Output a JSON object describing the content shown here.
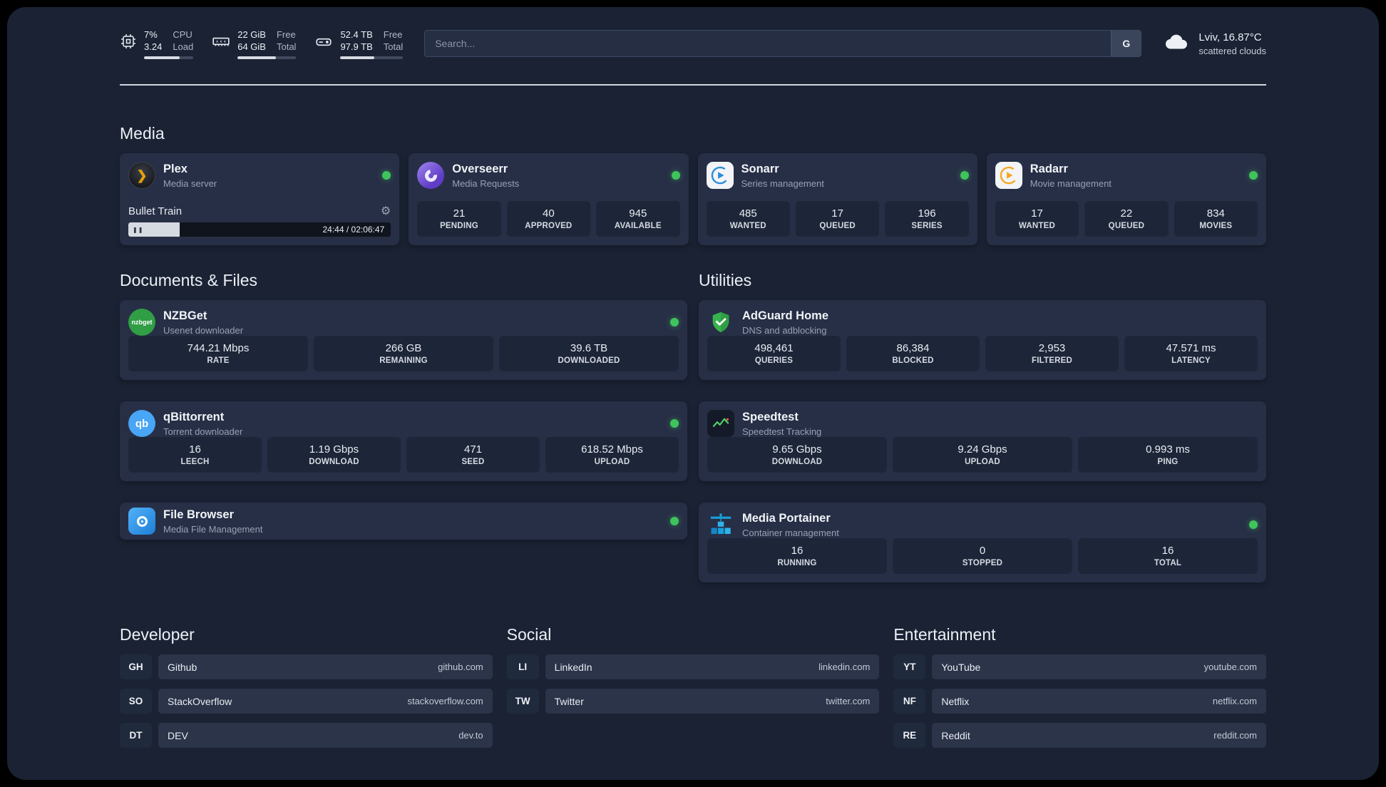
{
  "colors": {
    "background": "#1a2234",
    "card": "#272f46",
    "stat_box": "#1d2638",
    "status_green": "#3fc35c",
    "plex_accent": "#e5a00d"
  },
  "icons": {
    "gear": "⚙",
    "pause": "❚❚",
    "plex_chevron": "❯",
    "qbittorrent_label": "qb",
    "nzbget_label": "nzbget"
  },
  "topbar": {
    "cpu": {
      "value_top": "7%",
      "value_bottom": "3.24",
      "label_top": "CPU",
      "label_bottom": "Load",
      "progress": 72
    },
    "ram": {
      "value_top": "22 GiB",
      "value_bottom": "64 GiB",
      "label_top": "Free",
      "label_bottom": "Total",
      "progress": 66
    },
    "disk": {
      "value_top": "52.4 TB",
      "value_bottom": "97.9 TB",
      "label_top": "Free",
      "label_bottom": "Total",
      "progress": 54
    },
    "search": {
      "placeholder": "Search...",
      "button": "G"
    },
    "weather": {
      "location": "Lviv, 16.87°C",
      "condition": "scattered clouds"
    }
  },
  "media": {
    "title": "Media",
    "plex": {
      "title": "Plex",
      "subtitle": "Media server",
      "now_playing": "Bullet Train",
      "time": "24:44 / 02:06:47",
      "progress": 19.5
    },
    "overseerr": {
      "title": "Overseerr",
      "subtitle": "Media Requests",
      "stats": [
        {
          "value": "21",
          "label": "PENDING"
        },
        {
          "value": "40",
          "label": "APPROVED"
        },
        {
          "value": "945",
          "label": "AVAILABLE"
        }
      ]
    },
    "sonarr": {
      "title": "Sonarr",
      "subtitle": "Series management",
      "stats": [
        {
          "value": "485",
          "label": "WANTED"
        },
        {
          "value": "17",
          "label": "QUEUED"
        },
        {
          "value": "196",
          "label": "SERIES"
        }
      ]
    },
    "radarr": {
      "title": "Radarr",
      "subtitle": "Movie management",
      "stats": [
        {
          "value": "17",
          "label": "WANTED"
        },
        {
          "value": "22",
          "label": "QUEUED"
        },
        {
          "value": "834",
          "label": "MOVIES"
        }
      ]
    }
  },
  "documents": {
    "title": "Documents & Files",
    "nzbget": {
      "title": "NZBGet",
      "subtitle": "Usenet downloader",
      "stats": [
        {
          "value": "744.21 Mbps",
          "label": "RATE"
        },
        {
          "value": "266 GB",
          "label": "REMAINING"
        },
        {
          "value": "39.6 TB",
          "label": "DOWNLOADED"
        }
      ]
    },
    "qbittorrent": {
      "title": "qBittorrent",
      "subtitle": "Torrent downloader",
      "stats": [
        {
          "value": "16",
          "label": "LEECH"
        },
        {
          "value": "1.19 Gbps",
          "label": "DOWNLOAD"
        },
        {
          "value": "471",
          "label": "SEED"
        },
        {
          "value": "618.52 Mbps",
          "label": "UPLOAD"
        }
      ]
    },
    "filebrowser": {
      "title": "File Browser",
      "subtitle": "Media File Management"
    }
  },
  "utilities": {
    "title": "Utilities",
    "adguard": {
      "title": "AdGuard Home",
      "subtitle": "DNS and adblocking",
      "stats": [
        {
          "value": "498,461",
          "label": "QUERIES"
        },
        {
          "value": "86,384",
          "label": "BLOCKED"
        },
        {
          "value": "2,953",
          "label": "FILTERED"
        },
        {
          "value": "47.571 ms",
          "label": "LATENCY"
        }
      ]
    },
    "speedtest": {
      "title": "Speedtest",
      "subtitle": "Speedtest Tracking",
      "stats": [
        {
          "value": "9.65 Gbps",
          "label": "DOWNLOAD"
        },
        {
          "value": "9.24 Gbps",
          "label": "UPLOAD"
        },
        {
          "value": "0.993 ms",
          "label": "PING"
        }
      ]
    },
    "portainer": {
      "title": "Media Portainer",
      "subtitle": "Container management",
      "stats": [
        {
          "value": "16",
          "label": "RUNNING"
        },
        {
          "value": "0",
          "label": "STOPPED"
        },
        {
          "value": "16",
          "label": "TOTAL"
        }
      ]
    }
  },
  "links": {
    "developer": {
      "title": "Developer",
      "items": [
        {
          "abbr": "GH",
          "name": "Github",
          "url": "github.com"
        },
        {
          "abbr": "SO",
          "name": "StackOverflow",
          "url": "stackoverflow.com"
        },
        {
          "abbr": "DT",
          "name": "DEV",
          "url": "dev.to"
        }
      ]
    },
    "social": {
      "title": "Social",
      "items": [
        {
          "abbr": "LI",
          "name": "LinkedIn",
          "url": "linkedin.com"
        },
        {
          "abbr": "TW",
          "name": "Twitter",
          "url": "twitter.com"
        }
      ]
    },
    "entertainment": {
      "title": "Entertainment",
      "items": [
        {
          "abbr": "YT",
          "name": "YouTube",
          "url": "youtube.com"
        },
        {
          "abbr": "NF",
          "name": "Netflix",
          "url": "netflix.com"
        },
        {
          "abbr": "RE",
          "name": "Reddit",
          "url": "reddit.com"
        }
      ]
    }
  }
}
